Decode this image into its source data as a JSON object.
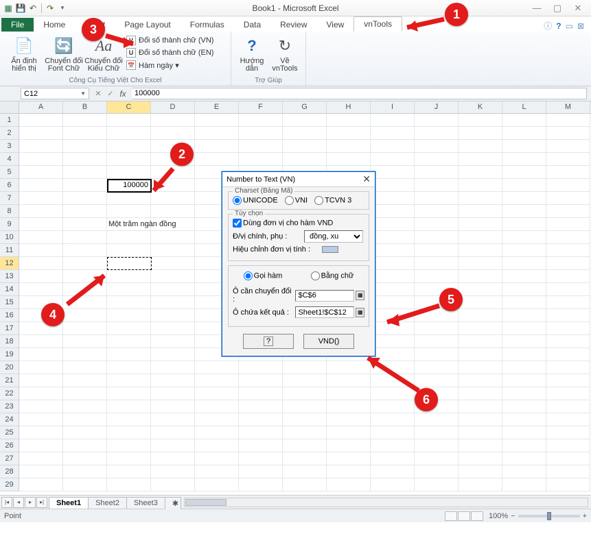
{
  "window": {
    "title": "Book1 - Microsoft Excel"
  },
  "qat": {
    "save": "💾",
    "undo": "↶",
    "redo": "↷"
  },
  "tabs": {
    "file": "File",
    "home": "Home",
    "insert": "Insert",
    "pagelayout": "Page Layout",
    "formulas": "Formulas",
    "data": "Data",
    "review": "Review",
    "view": "View",
    "vntools": "vnTools"
  },
  "ribbon": {
    "freeze": {
      "line1": "Ẩn định",
      "line2": "hiển thị"
    },
    "fontconv": {
      "line1": "Chuyển đổi",
      "line2": "Font Chữ"
    },
    "caseconv": {
      "line1": "Chuyển đổi",
      "line2": "Kiểu Chữ"
    },
    "numvn": "Đổi số thành chữ (VN)",
    "numen": "Đổi số thành chữ (EN)",
    "hamngay": "Hàm ngày ▾",
    "group1": "Công Cụ Tiếng Việt Cho Excel",
    "guide": {
      "line1": "Hướng",
      "line2": "dẫn"
    },
    "about": {
      "line1": "Về",
      "line2": "vnTools"
    },
    "group2": "Trợ Giúp"
  },
  "formula": {
    "namebox": "C12",
    "value": "100000"
  },
  "columns": [
    "A",
    "B",
    "C",
    "D",
    "E",
    "F",
    "G",
    "H",
    "I",
    "J",
    "K",
    "L",
    "M"
  ],
  "cells": {
    "c6": "100000",
    "c9": "Một trăm ngàn đồng"
  },
  "sheets": {
    "s1": "Sheet1",
    "s2": "Sheet2",
    "s3": "Sheet3"
  },
  "status": {
    "mode": "Point",
    "zoom": "100%"
  },
  "dialog": {
    "title": "Number to Text (VN)",
    "charset_legend": "Charset (Bảng Mã)",
    "charset": {
      "unicode": "UNICODE",
      "vni": "VNI",
      "tcvn": "TCVN 3"
    },
    "opts_legend": "Tùy chọn",
    "use_unit": "Dùng đơn vị cho hàm VND",
    "main_sub": "Đ/vị chính, phụ :",
    "unit_sel": "đồng, xu",
    "adj": "Hiệu chỉnh đơn vị tính :",
    "callfn": "Gọi hàm",
    "bytext": "Bằng chữ",
    "src_label": "Ô cần chuyển đổi :",
    "src_val": "$C$6",
    "dst_label": "Ô chứa kết quả :",
    "dst_val": "Sheet1!$C$12",
    "helpbtn": "?",
    "vndbtn": "VND()"
  },
  "callouts": {
    "c1": "1",
    "c2": "2",
    "c3": "3",
    "c4": "4",
    "c5": "5",
    "c6": "6"
  }
}
